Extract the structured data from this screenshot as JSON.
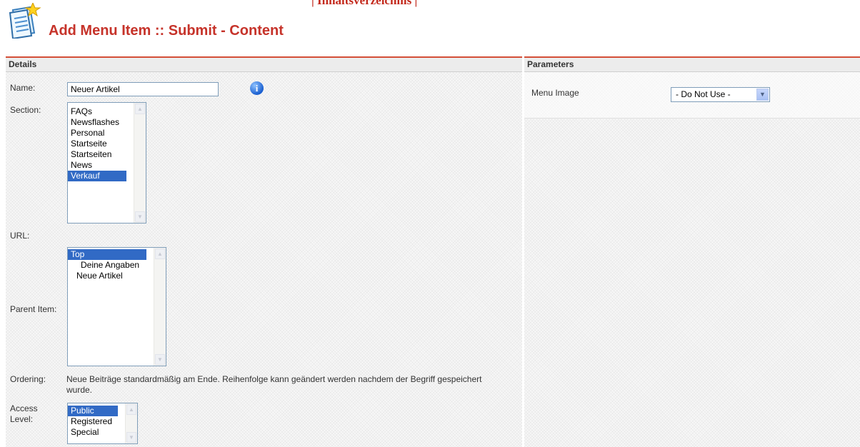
{
  "top_link": "| Inhaltsverzeichnis |",
  "page_title": "Add Menu Item :: Submit - Content",
  "details": {
    "heading": "Details",
    "name_label": "Name:",
    "name_value": "Neuer Artikel",
    "section_label": "Section:",
    "sections": [
      "FAQs",
      "Newsflashes",
      "Personal",
      "Startseite",
      "Startseiten",
      "News",
      "Verkauf"
    ],
    "url_label": "URL:",
    "parent_label": "Parent Item:",
    "parent_items": [
      "Top",
      "Deine Angaben",
      "Neue Artikel"
    ],
    "ordering_label": "Ordering:",
    "ordering_text": "Neue Beiträge standardmäßig am Ende. Reihenfolge kann geändert werden nachdem der Begriff gespeichert wurde.",
    "access_label_1": "Access",
    "access_label_2": "Level:",
    "access_levels": [
      "Public",
      "Registered",
      "Special"
    ]
  },
  "parameters": {
    "heading": "Parameters",
    "menu_image_label": "Menu Image",
    "menu_image_value": "- Do Not Use -"
  },
  "colors": {
    "accent": "#c6332a",
    "selection": "#316ac5",
    "panel_rule": "#d44e37"
  },
  "icons": {
    "header": "menu-item-add-icon",
    "info": "info-icon"
  }
}
